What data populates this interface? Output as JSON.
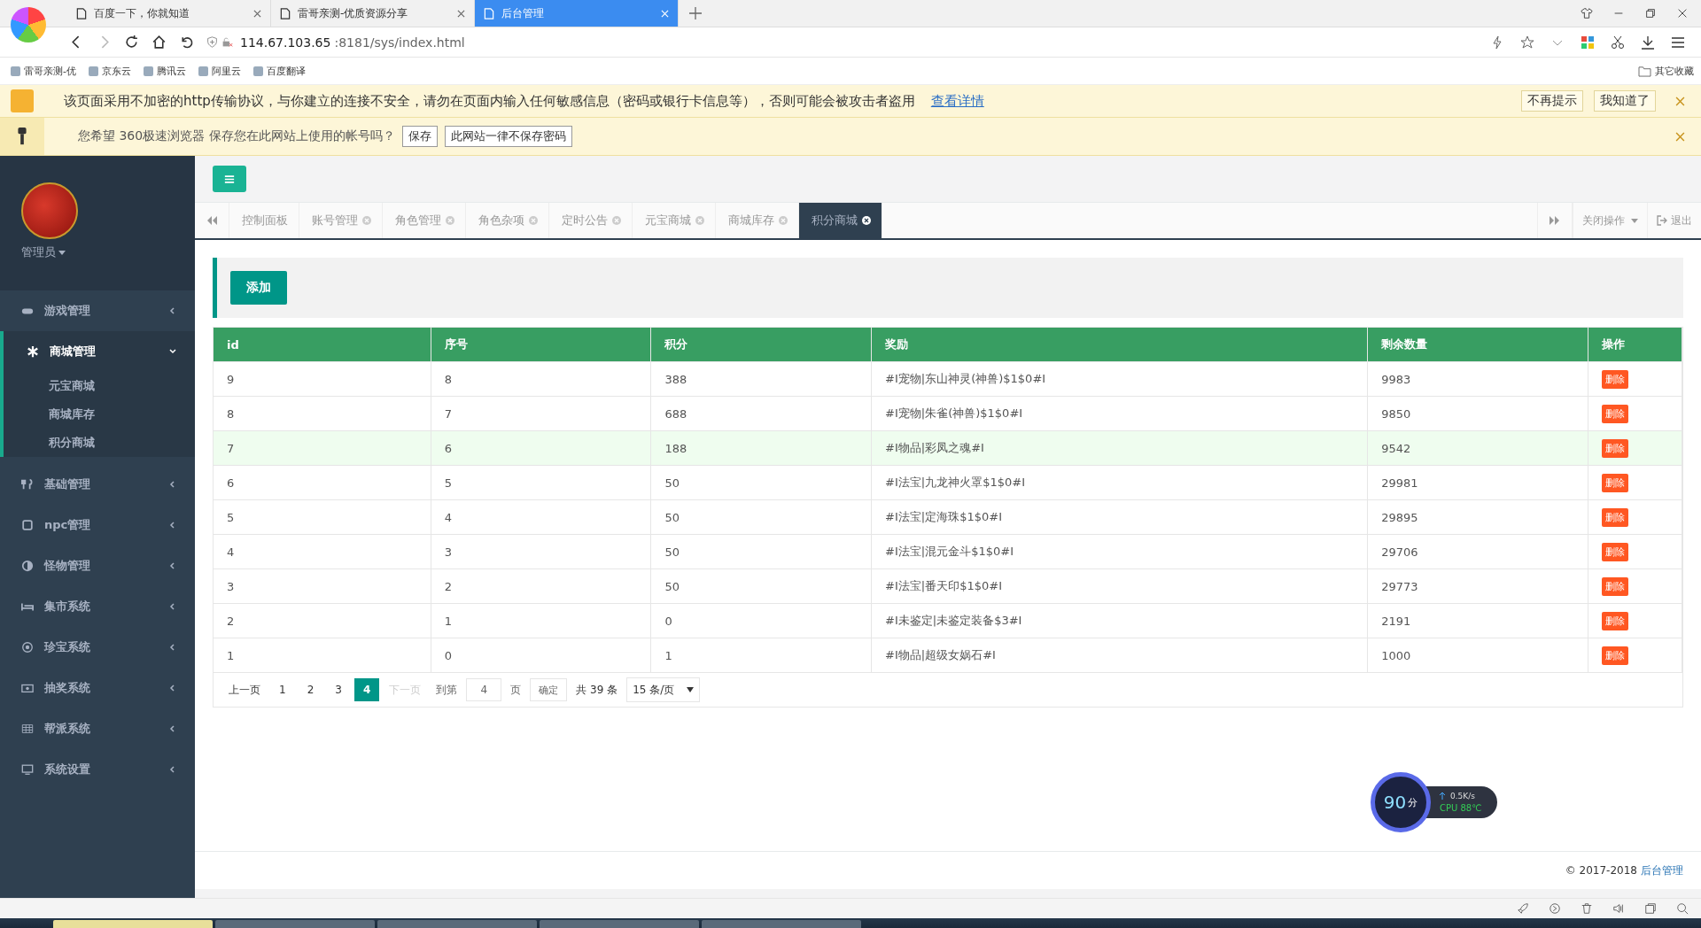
{
  "browser": {
    "tabs": [
      {
        "title": "百度一下，你就知道",
        "selected": false
      },
      {
        "title": "雷哥亲测-优质资源分享",
        "selected": false
      },
      {
        "title": "后台管理",
        "selected": true
      }
    ],
    "url_host": "114.67.103.65",
    "url_rest": ":8181/sys/index.html",
    "bookmarks": [
      "雷哥亲测-优",
      "京东云",
      "腾讯云",
      "阿里云",
      "百度翻译"
    ],
    "other_bookmarks": "其它收藏"
  },
  "security_bar": {
    "message": "该页面采用不加密的http传输协议，与你建立的连接不安全，请勿在页面内输入任何敏感信息（密码或银行卡信息等），否则可能会被攻击者盗用",
    "link": "查看详情",
    "buttons": [
      "不再提示",
      "我知道了"
    ]
  },
  "password_bar": {
    "message": "您希望 360极速浏览器 保存您在此网站上使用的帐号吗？",
    "buttons": [
      "保存",
      "此网站一律不保存密码"
    ]
  },
  "sidebar": {
    "user": "管理员",
    "menu": [
      {
        "label": "游戏管理",
        "expanded": false
      },
      {
        "label": "商城管理",
        "expanded": true,
        "children": [
          {
            "label": "元宝商城"
          },
          {
            "label": "商城库存"
          },
          {
            "label": "积分商城"
          }
        ]
      },
      {
        "label": "基础管理",
        "expanded": false
      },
      {
        "label": "npc管理",
        "expanded": false
      },
      {
        "label": "怪物管理",
        "expanded": false
      },
      {
        "label": "集市系统",
        "expanded": false
      },
      {
        "label": "珍宝系统",
        "expanded": false
      },
      {
        "label": "抽奖系统",
        "expanded": false
      },
      {
        "label": "帮派系统",
        "expanded": false
      },
      {
        "label": "系统设置",
        "expanded": false
      }
    ]
  },
  "page_tabs": [
    {
      "label": "控制面板",
      "closable": false,
      "selected": false
    },
    {
      "label": "账号管理",
      "closable": true,
      "selected": false
    },
    {
      "label": "角色管理",
      "closable": true,
      "selected": false
    },
    {
      "label": "角色杂项",
      "closable": true,
      "selected": false
    },
    {
      "label": "定时公告",
      "closable": true,
      "selected": false
    },
    {
      "label": "元宝商城",
      "closable": true,
      "selected": false
    },
    {
      "label": "商城库存",
      "closable": true,
      "selected": false
    },
    {
      "label": "积分商城",
      "closable": true,
      "selected": true
    }
  ],
  "tab_tools": {
    "close_menu": "关闭操作",
    "logout": "退出"
  },
  "add_button": "添加",
  "table": {
    "columns": [
      "id",
      "序号",
      "积分",
      "奖励",
      "剩余数量",
      "操作"
    ],
    "rows": [
      {
        "cells": [
          "9",
          "8",
          "388",
          "#I宠物|东山神灵(神兽)$1$0#I",
          "9983"
        ],
        "action": "删除",
        "highlighted": false
      },
      {
        "cells": [
          "8",
          "7",
          "688",
          "#I宠物|朱雀(神兽)$1$0#I",
          "9850"
        ],
        "action": "删除",
        "highlighted": false
      },
      {
        "cells": [
          "7",
          "6",
          "188",
          "#I物品|彩凤之魂#I",
          "9542"
        ],
        "action": "删除",
        "highlighted": true
      },
      {
        "cells": [
          "6",
          "5",
          "50",
          "#I法宝|九龙神火罩$1$0#I",
          "29981"
        ],
        "action": "删除",
        "highlighted": false
      },
      {
        "cells": [
          "5",
          "4",
          "50",
          "#I法宝|定海珠$1$0#I",
          "29895"
        ],
        "action": "删除",
        "highlighted": false
      },
      {
        "cells": [
          "4",
          "3",
          "50",
          "#I法宝|混元金斗$1$0#I",
          "29706"
        ],
        "action": "删除",
        "highlighted": false
      },
      {
        "cells": [
          "3",
          "2",
          "50",
          "#I法宝|番天印$1$0#I",
          "29773"
        ],
        "action": "删除",
        "highlighted": false
      },
      {
        "cells": [
          "2",
          "1",
          "0",
          "#I未鉴定|未鉴定装备$3#I",
          "2191"
        ],
        "action": "删除",
        "highlighted": false
      },
      {
        "cells": [
          "1",
          "0",
          "1",
          "#I物品|超级女娲石#I",
          "1000"
        ],
        "action": "删除",
        "highlighted": false
      }
    ]
  },
  "pagination": {
    "prev": "上一页",
    "pages": [
      {
        "label": "1",
        "selected": false
      },
      {
        "label": "2",
        "selected": false
      },
      {
        "label": "3",
        "selected": false
      },
      {
        "label": "4",
        "selected": true
      }
    ],
    "next": "下一页",
    "next_disabled": true,
    "goto_label": "到第",
    "goto_value": "4",
    "page_unit": "页",
    "confirm": "确定",
    "total": "共 39 条",
    "page_size": "15 条/页"
  },
  "footer": {
    "copyright": "© 2017-2018",
    "link": "后台管理"
  },
  "speed_widget": {
    "score": "90",
    "unit": "分",
    "speed": "0.5K/s",
    "cpu": "CPU 88℃"
  }
}
